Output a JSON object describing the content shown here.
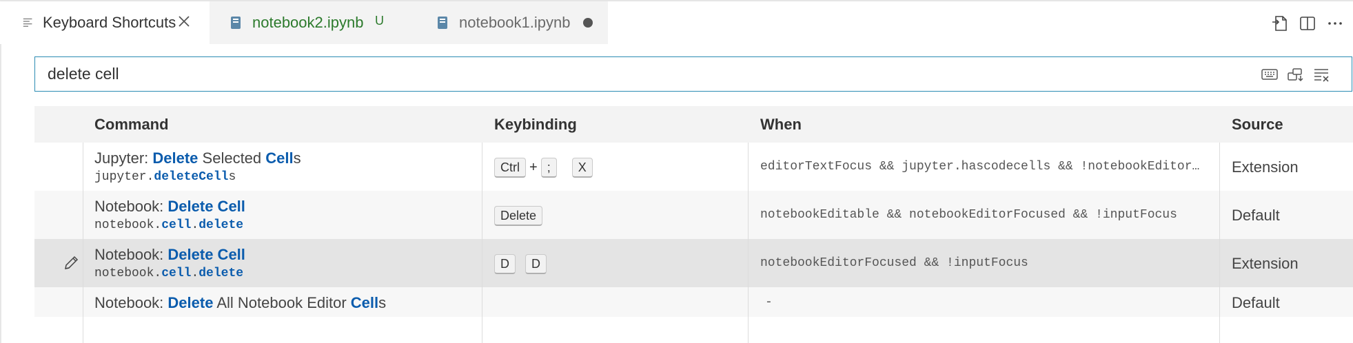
{
  "tabs": [
    {
      "label": "Keyboard Shortcuts",
      "icon": "list-icon",
      "close": "close-icon"
    },
    {
      "label": "notebook2.ipynb",
      "icon": "notebook-icon",
      "badge": "U"
    },
    {
      "label": "notebook1.ipynb",
      "icon": "notebook-icon",
      "dirty": "dot"
    }
  ],
  "actions": [
    "open-json-icon",
    "split-editor-icon",
    "more-icon"
  ],
  "search": {
    "value": "delete cell"
  },
  "search_icons": [
    "record-keys-icon",
    "sort-by-precedence-icon",
    "clear-filter-icon"
  ],
  "columns": {
    "command": "Command",
    "keybinding": "Keybinding",
    "when": "When",
    "source": "Source"
  },
  "rows": [
    {
      "title_prefix": "Jupyter: ",
      "title_parts": [
        "Delete",
        " Selected ",
        "Cell",
        "s"
      ],
      "id_parts": [
        "jupyter.",
        "deleteCell",
        "s"
      ],
      "keys": [
        "Ctrl",
        "+",
        ";",
        "X"
      ],
      "when": "editorTextFocus && jupyter.hascodecells && !notebookEditor…",
      "source": "Extension"
    },
    {
      "title_prefix": "Notebook: ",
      "title_parts": [
        "Delete Cell"
      ],
      "id_parts": [
        "notebook.",
        "cell",
        ".",
        "delete"
      ],
      "keys": [
        "Delete"
      ],
      "when": "notebookEditable && notebookEditorFocused && !inputFocus",
      "source": "Default"
    },
    {
      "title_prefix": "Notebook: ",
      "title_parts": [
        "Delete Cell"
      ],
      "id_parts": [
        "notebook.",
        "cell",
        ".",
        "delete"
      ],
      "keys": [
        "D",
        "D"
      ],
      "when": "notebookEditorFocused && !inputFocus",
      "source": "Extension",
      "selected": true
    },
    {
      "title_prefix": "Notebook: ",
      "title_parts": [
        "Delete",
        " All Notebook Editor ",
        "Cell",
        "s"
      ],
      "when": "-",
      "source": "Default"
    }
  ],
  "colors": {
    "accent": "#0b5cad",
    "tab_modified": "#2c7a2c",
    "focus_border": "#2a8bb3"
  }
}
